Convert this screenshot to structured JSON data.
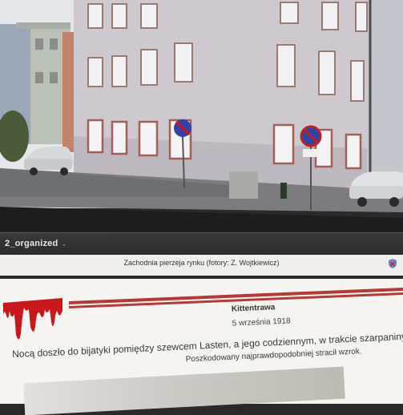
{
  "screen": {
    "folder_name": "2_organized",
    "chevron_icon": "chevron-down-icon",
    "photo_caption": "Zachodnia pierzeja rynku (fotory: Z. Wojtkiewicz)",
    "badge_icon": "shield-badge-icon"
  },
  "article": {
    "title": "Kittentrawa",
    "date": "5 września 1918",
    "body_line1": "Nocą doszło do bijatyki pomiędzy szewcem Lasten, a jego codziennym, w trakcie szarpaniny szewc...",
    "body_line2": "Poszkodowany najprawdopodobniej stracił wzrok."
  },
  "colors": {
    "building": "#c9c5cc",
    "sky": "#e3e6ea",
    "blood": "#c8181b",
    "stripe": "#b43a36"
  }
}
